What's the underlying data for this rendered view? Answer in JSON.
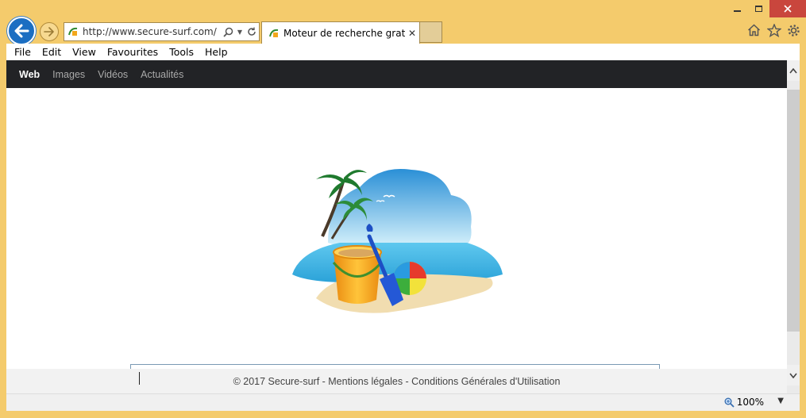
{
  "browser": {
    "address_url": "http://www.secure-surf.com/",
    "tab_title": "Moteur de recherche gratui...",
    "menu": [
      "File",
      "Edit",
      "View",
      "Favourites",
      "Tools",
      "Help"
    ],
    "zoom": "100%"
  },
  "site": {
    "nav": [
      "Web",
      "Images",
      "Vidéos",
      "Actualités"
    ],
    "footer": "© 2017 Secure-surf - Mentions légales - Conditions Générales d'Utilisation"
  },
  "colors": {
    "frame": "#f4cb6c",
    "back_button": "#1b6ec2",
    "site_nav_bg": "#222326",
    "close_button": "#c9463d"
  },
  "icons": [
    "back-arrow-icon",
    "forward-arrow-icon",
    "favicon-icon",
    "search-icon",
    "refresh-icon",
    "home-icon",
    "star-icon",
    "gear-icon",
    "zoom-icon"
  ]
}
